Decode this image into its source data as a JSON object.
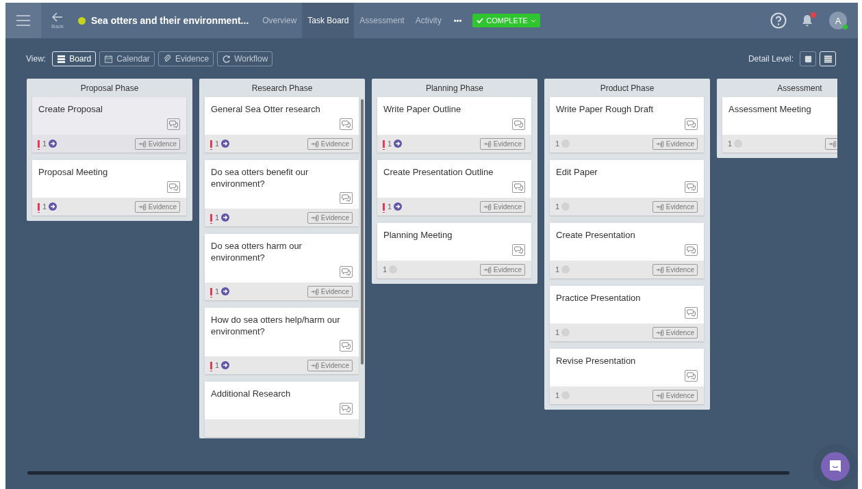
{
  "header": {
    "back_label": "Back",
    "project_title": "Sea otters and their environment...",
    "tabs": [
      {
        "label": "Overview",
        "selected": false
      },
      {
        "label": "Task Board",
        "selected": true
      },
      {
        "label": "Assessment",
        "selected": false
      },
      {
        "label": "Activity",
        "selected": false
      }
    ],
    "more": "•••",
    "status_button": "COMPLETE",
    "avatar_initial": "A",
    "has_notification": true
  },
  "view_bar": {
    "label": "View:",
    "views": [
      {
        "label": "Board",
        "selected": true
      },
      {
        "label": "Calendar",
        "selected": false
      },
      {
        "label": "Evidence",
        "selected": false
      },
      {
        "label": "Workflow",
        "selected": false
      }
    ],
    "detail_label": "Detail Level:",
    "detail_levels": [
      {
        "selected": false
      },
      {
        "selected": true
      }
    ]
  },
  "columns": [
    {
      "title": "Proposal Phase",
      "scrollable": false,
      "cards": [
        {
          "title": "Create Proposal",
          "selected": true,
          "flagged": true,
          "count": "1",
          "active": true,
          "evidence": "Evidence"
        },
        {
          "title": "Proposal Meeting",
          "selected": false,
          "flagged": true,
          "count": "1",
          "active": true,
          "evidence": "Evidence"
        }
      ]
    },
    {
      "title": "Research Phase",
      "scrollable": true,
      "cards": [
        {
          "title": "General Sea Otter research",
          "selected": false,
          "flagged": true,
          "count": "1",
          "active": true,
          "evidence": "Evidence"
        },
        {
          "title": "Do sea otters benefit our environment?",
          "selected": false,
          "flagged": true,
          "count": "1",
          "active": true,
          "evidence": "Evidence"
        },
        {
          "title": "Do sea otters harm our environment?",
          "selected": false,
          "flagged": true,
          "count": "1",
          "active": true,
          "evidence": "Evidence"
        },
        {
          "title": "How do sea otters help/harm our environment?",
          "selected": false,
          "flagged": true,
          "count": "1",
          "active": true,
          "evidence": "Evidence"
        },
        {
          "title": "Additional Research",
          "selected": false
        }
      ]
    },
    {
      "title": "Planning Phase",
      "scrollable": false,
      "cards": [
        {
          "title": "Write Paper Outline",
          "selected": false,
          "flagged": true,
          "count": "1",
          "active": true,
          "evidence": "Evidence"
        },
        {
          "title": "Create Presentation Outline",
          "selected": false,
          "flagged": true,
          "count": "1",
          "active": true,
          "evidence": "Evidence"
        },
        {
          "title": "Planning Meeting",
          "selected": false,
          "flagged": false,
          "count": "1",
          "active": false,
          "evidence": "Evidence"
        }
      ]
    },
    {
      "title": "Product Phase",
      "scrollable": false,
      "cards": [
        {
          "title": "Write Paper Rough Draft",
          "selected": false,
          "flagged": false,
          "count": "1",
          "active": false,
          "evidence": "Evidence"
        },
        {
          "title": "Edit Paper",
          "selected": false,
          "flagged": false,
          "count": "1",
          "active": false,
          "evidence": "Evidence"
        },
        {
          "title": "Create Presentation",
          "selected": false,
          "flagged": false,
          "count": "1",
          "active": false,
          "evidence": "Evidence"
        },
        {
          "title": "Practice Presentation",
          "selected": false,
          "flagged": false,
          "count": "1",
          "active": false,
          "evidence": "Evidence"
        },
        {
          "title": "Revise Presentation",
          "selected": false,
          "flagged": false,
          "count": "1",
          "active": false,
          "evidence": "Evidence"
        }
      ]
    },
    {
      "title": "Assessment",
      "scrollable": false,
      "cards": [
        {
          "title": "Assessment Meeting",
          "selected": false,
          "flagged": false,
          "count": "1",
          "active": false
        }
      ]
    }
  ]
}
